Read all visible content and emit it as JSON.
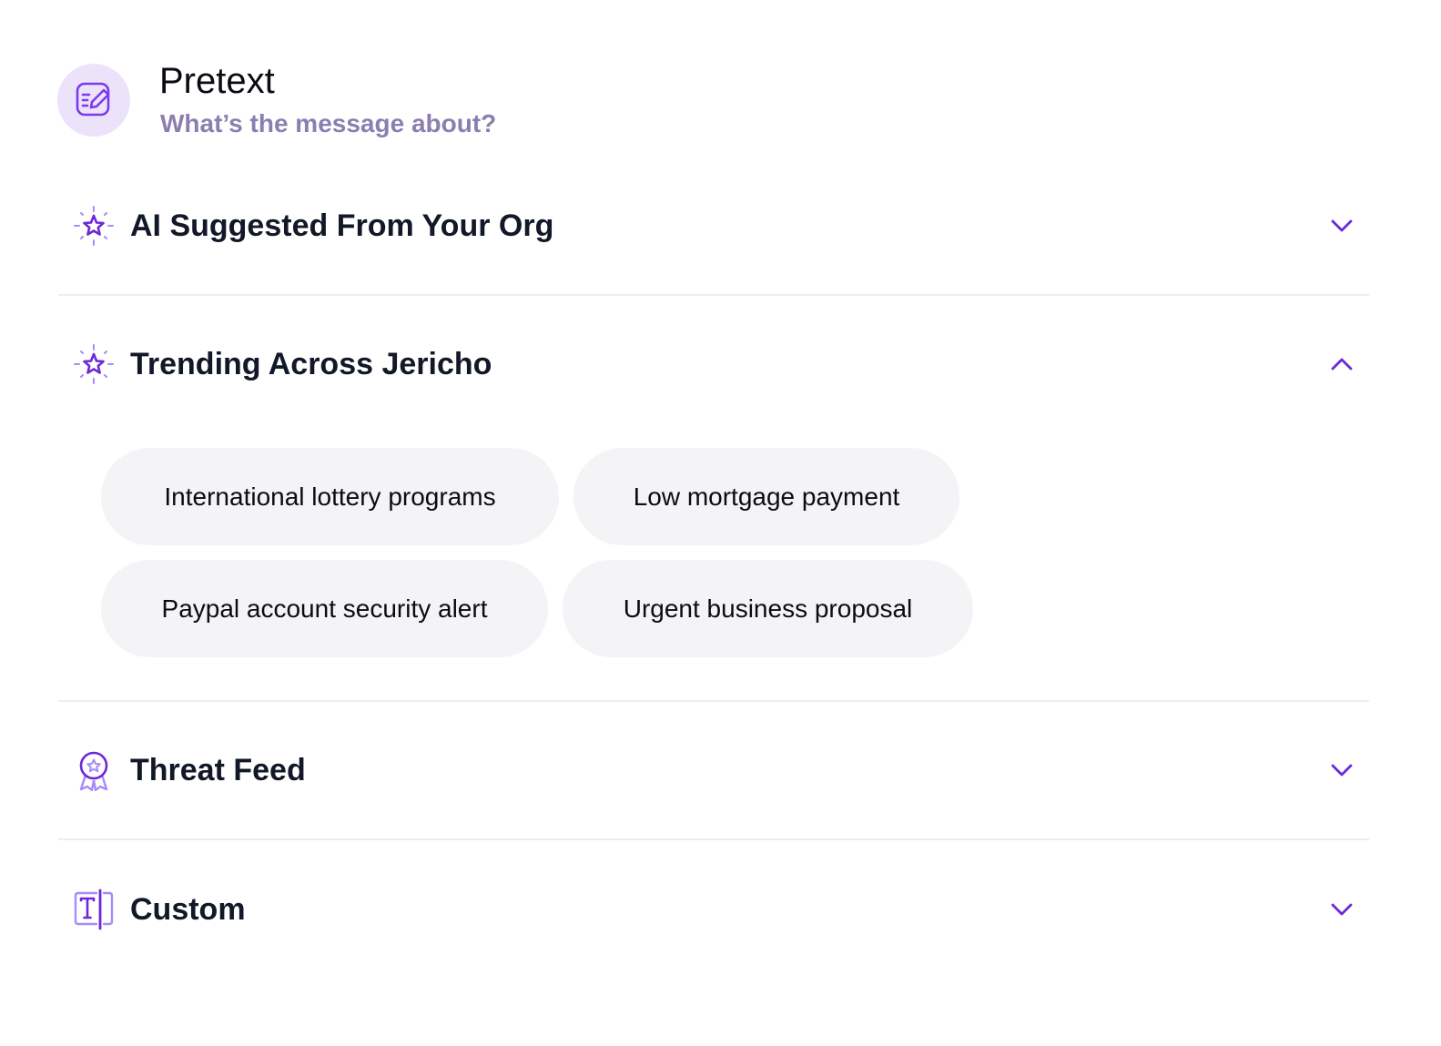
{
  "header": {
    "title": "Pretext",
    "subtitle": "What’s the message about?",
    "icon": "edit-note-icon"
  },
  "sections": [
    {
      "title": "AI Suggested From Your Org",
      "icon": "sparkle-star-icon",
      "expanded": false
    },
    {
      "title": "Trending Across Jericho",
      "icon": "sparkle-star-icon",
      "expanded": true,
      "chips": [
        "International lottery programs",
        "Low mortgage payment",
        "Paypal account security alert",
        "Urgent business proposal"
      ]
    },
    {
      "title": "Threat Feed",
      "icon": "award-badge-icon",
      "expanded": false
    },
    {
      "title": "Custom",
      "icon": "text-cursor-icon",
      "expanded": false
    }
  ],
  "colors": {
    "accent": "#6d28d9",
    "icon_bg": "#ece3fb",
    "subtitle": "#8a7fb0",
    "chip_bg": "#f4f4f6",
    "divider": "#eeeef1"
  }
}
